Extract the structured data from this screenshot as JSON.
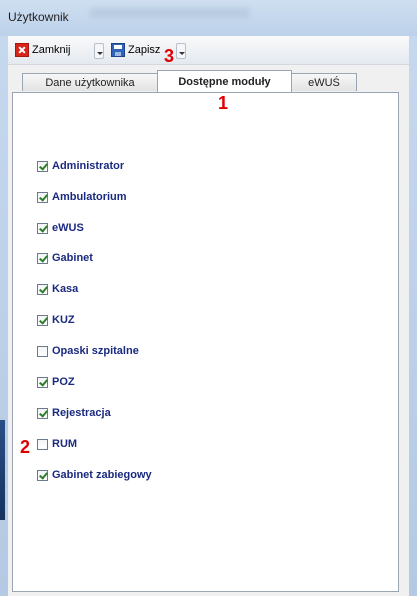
{
  "window": {
    "title": "Użytkownik"
  },
  "toolbar": {
    "close_label": "Zamknij",
    "save_label": "Zapisz",
    "close_icon": "close-icon",
    "save_icon": "floppy-disk-icon"
  },
  "tabs": [
    {
      "label": "Dane użytkownika",
      "active": false
    },
    {
      "label": "Dostępne moduły",
      "active": true
    },
    {
      "label": "eWUŚ",
      "active": false
    }
  ],
  "modules": [
    {
      "label": "Administrator",
      "checked": true
    },
    {
      "label": "Ambulatorium",
      "checked": true
    },
    {
      "label": "eWUS",
      "checked": true
    },
    {
      "label": "Gabinet",
      "checked": true
    },
    {
      "label": "Kasa",
      "checked": true
    },
    {
      "label": "KUZ",
      "checked": true
    },
    {
      "label": "Opaski szpitalne",
      "checked": false
    },
    {
      "label": "POZ",
      "checked": true
    },
    {
      "label": "Rejestracja",
      "checked": true
    },
    {
      "label": "RUM",
      "checked": false
    },
    {
      "label": "Gabinet zabiegowy",
      "checked": true
    }
  ],
  "annotations": {
    "marker_1": "1",
    "marker_2": "2",
    "marker_3": "3"
  },
  "colors": {
    "annotation": "#e00000",
    "label": "#1a2a80",
    "titlebar": "#c8daef"
  }
}
